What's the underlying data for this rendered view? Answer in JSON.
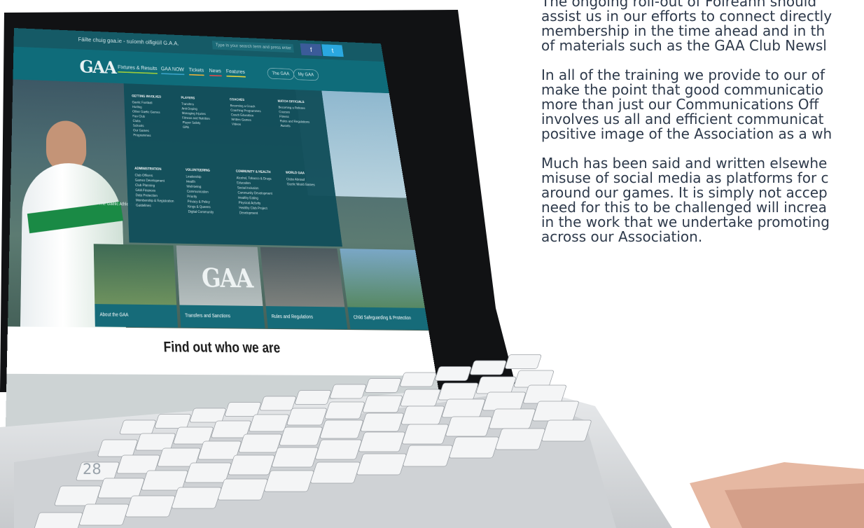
{
  "article": {
    "paragraphs": [
      [
        "The ongoing roll-out of Foireann should",
        "assist us in our efforts to connect directly",
        "membership in the time ahead and in th",
        "of materials such as the GAA Club Newsl"
      ],
      [
        "In all of the training we provide to our of",
        "make the point that good communicatio",
        "more than just our Communications Off",
        "involves us all and efficient communicat",
        "positive image of the Association as a wh"
      ],
      [
        "Much has been said and written elsewhe",
        "misuse of social media as platforms for c",
        "around our games. It is simply not accep",
        "need for this to be challenged will increa",
        "in the work that we undertake promoting",
        "across our Association."
      ]
    ]
  },
  "page_number": "28",
  "website": {
    "tagline": "Fáilte chuig gaa.ie - suíomh oifigiúil G.A.A.",
    "search_placeholder": "Type in your search term and press enter",
    "social": {
      "facebook": "f",
      "twitter": "t"
    },
    "logo": "GAA",
    "nav": [
      "Fixtures & Results",
      "GAA NOW",
      "Tickets",
      "News",
      "Features"
    ],
    "nav_buttons": [
      "The GAA",
      "My GAA"
    ],
    "megamenu": [
      {
        "heading": "GETTING INVOLVED",
        "items": [
          "Gaelic Football",
          "Hurling",
          "Other Gaelic Games",
          "Fan Club",
          "Clubs",
          "Schools",
          "Our Games",
          "Programmes"
        ]
      },
      {
        "heading": "PLAYERS",
        "items": [
          "Transfers",
          "Anti-Doping",
          "Managing Injuries",
          "Fitness and Nutrition",
          "Player Safety",
          "GPA"
        ]
      },
      {
        "heading": "COACHES",
        "items": [
          "Becoming a Coach",
          "Coaching Programmes",
          "Coach Education",
          "Written Games",
          "Videos"
        ]
      },
      {
        "heading": "MATCH OFFICIALS",
        "items": [
          "Becoming a Referee",
          "Courses",
          "Fitness",
          "Rules and Regulations",
          "Awards"
        ]
      },
      {
        "heading": "ADMINISTRATION",
        "items": [
          "Club Officers",
          "Games Development",
          "Club Planning",
          "GAA Finances",
          "Data Protection",
          "Membership & Registration",
          "Guidelines"
        ]
      },
      {
        "heading": "VOLUNTEERING",
        "items": [
          "Leadership",
          "Health",
          "Well-being",
          "Communication",
          "Priority",
          "Privacy & Policy",
          "Kings & Queens",
          "Digital Community"
        ]
      },
      {
        "heading": "COMMUNITY & HEALTH",
        "items": [
          "Alcohol, Tobacco & Drugs",
          "Education",
          "Social Inclusion",
          "Community Development",
          "Healthy Eating",
          "Physical Activity",
          "Healthy Club Project",
          "Development"
        ]
      },
      {
        "heading": "WORLD GAA",
        "items": [
          "Clubs Abroad",
          "Gaelic World Games"
        ]
      }
    ],
    "hero_text": "The Gaelic Athletic Association",
    "tiles": [
      "About the GAA",
      "Transfers and Sanctions",
      "Rules and Regulations",
      "Child Safeguarding & Protection"
    ],
    "find_out": "Find out who we are"
  }
}
